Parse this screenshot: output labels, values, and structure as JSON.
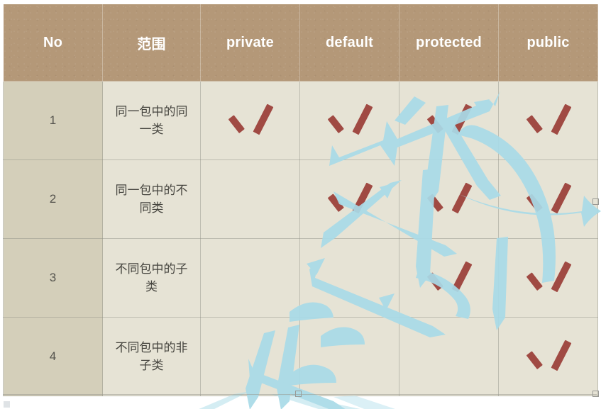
{
  "table": {
    "name": "java-access-modifier-table",
    "headers": [
      "No",
      "范围",
      "private",
      "default",
      "protected",
      "public"
    ],
    "rows": [
      {
        "no": "1",
        "scope": "同一包中的同一类",
        "private": true,
        "default": true,
        "protected": true,
        "public": true
      },
      {
        "no": "2",
        "scope": "同一包中的不同类",
        "private": false,
        "default": true,
        "protected": true,
        "public": true
      },
      {
        "no": "3",
        "scope": "不同包中的子类",
        "private": false,
        "default": false,
        "protected": true,
        "public": true
      },
      {
        "no": "4",
        "scope": "不同包中的非子类",
        "private": false,
        "default": false,
        "protected": false,
        "public": true
      }
    ]
  },
  "icons": {
    "check": "check-mark-icon"
  },
  "colors": {
    "header_bg": "#b49878",
    "header_text": "#ffffff",
    "no_column_bg": "#d4cfba",
    "cell_bg": "#e6e3d5",
    "cell_text": "#46453f",
    "check_mark": "#a04a43",
    "watermark": "#a9dbe8",
    "grid_line": "#8c8c82",
    "page_bg": "#ffffff"
  },
  "watermark": {
    "name": "calligraphy-watermark",
    "description": "light blue brush-stroke chinese calligraphy overlay"
  }
}
